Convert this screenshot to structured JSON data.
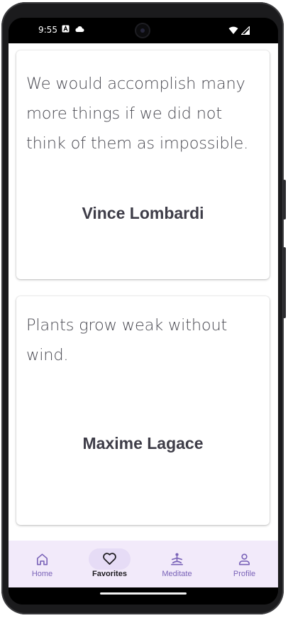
{
  "status_bar": {
    "time": "9:55"
  },
  "quotes": [
    {
      "text": "We would accomplish many more things if we did not think of them as impossible.",
      "author": "Vince Lombardi"
    },
    {
      "text": "Plants grow weak without wind.",
      "author": "Maxime Lagace"
    }
  ],
  "nav": {
    "items": [
      {
        "label": "Home",
        "icon": "home-icon",
        "active": false
      },
      {
        "label": "Favorites",
        "icon": "heart-icon",
        "active": true
      },
      {
        "label": "Meditate",
        "icon": "meditate-icon",
        "active": false
      },
      {
        "label": "Profile",
        "icon": "person-icon",
        "active": false
      }
    ]
  },
  "colors": {
    "nav_background": "#f2eafa",
    "nav_active_pill": "#e6dcf6",
    "nav_inactive_label": "#7a63b8",
    "quote_text": "#4a4a52",
    "author_text": "#3e3d48"
  }
}
